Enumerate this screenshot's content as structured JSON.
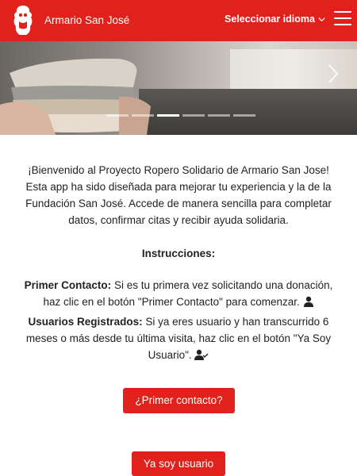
{
  "header": {
    "brand": "Armario San José",
    "language_label": "Seleccionar idioma",
    "logo_icon": "bear-logo-icon",
    "menu_icon": "hamburger-menu-icon",
    "background_color": "#e1211b"
  },
  "carousel": {
    "next_icon": "chevron-right-icon",
    "slides": 6,
    "active_slide": 3
  },
  "content": {
    "welcome": "¡Bienvenido al Proyecto Ropero Solidario de Armario San Jose! Esta app ha sido diseñada para mejorar tu experiencia y la de la Fundación San José. Accede de manera sencilla para completar datos, confirmar citas y recibir ayuda solidaria.",
    "instructions_title": "Instrucciones:",
    "first_contact_label": "Primer Contacto:",
    "first_contact_text": " Si es tu primera vez solicitando una donación, haz clic en el botón \"Primer Contacto\" para comenzar.",
    "first_contact_icon": "user-icon",
    "registered_label": "Usuarios Registrados:",
    "registered_text": " Si ya eres usuario y han transcurrido 6 meses o más desde tu última visita, haz clic en el botón \"Ya Soy Usuario\".",
    "registered_icon": "user-check-icon"
  },
  "buttons": {
    "first_contact": "¿Primer contacto?",
    "already_user": "Ya soy usuario",
    "color": "#e1211b"
  }
}
